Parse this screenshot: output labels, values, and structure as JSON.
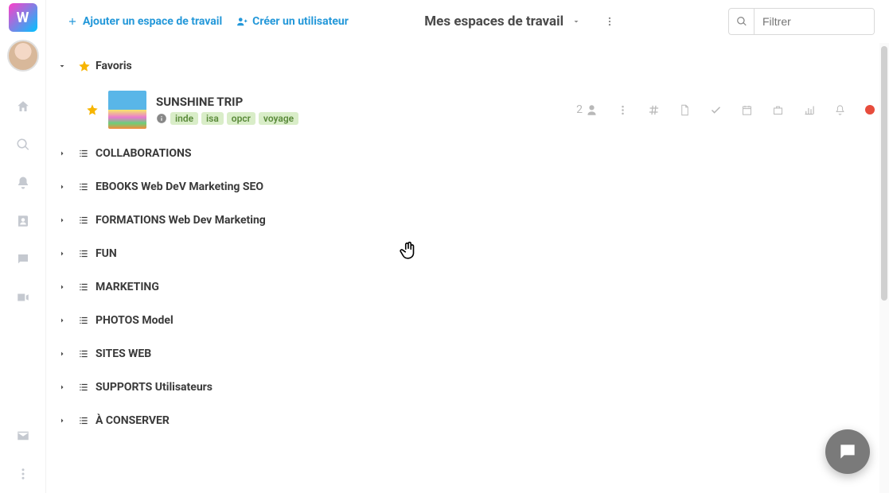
{
  "logoLetter": "W",
  "topbar": {
    "addWorkspace": "Ajouter un espace de travail",
    "createUser": "Créer un utilisateur",
    "viewTitle": "Mes espaces de travail"
  },
  "search": {
    "placeholder": "Filtrer",
    "value": ""
  },
  "favorites": {
    "label": "Favoris",
    "items": [
      {
        "title": "SUNSHINE TRIP",
        "tags": [
          "inde",
          "isa",
          "opcr",
          "voyage"
        ],
        "memberCount": "2"
      }
    ]
  },
  "categories": [
    {
      "label": "COLLABORATIONS"
    },
    {
      "label": "EBOOKS Web DeV Marketing SEO"
    },
    {
      "label": "FORMATIONS Web Dev Marketing"
    },
    {
      "label": "FUN"
    },
    {
      "label": "MARKETING"
    },
    {
      "label": "PHOTOS Model"
    },
    {
      "label": "SITES WEB"
    },
    {
      "label": "SUPPORTS Utilisateurs"
    },
    {
      "label": "À CONSERVER"
    }
  ],
  "sideNav": {
    "home": "home-icon",
    "search": "search-icon",
    "notifications": "bell-icon",
    "contacts": "contacts-icon",
    "chat": "chat-icon",
    "video": "video-icon",
    "mail": "mail-icon",
    "more": "more-icon"
  },
  "colors": {
    "accent": "#2498d9",
    "star": "#f7b500",
    "tagBg": "#d9edc8",
    "tagFg": "#5a8a3a",
    "statusDot": "#e74c3c"
  }
}
